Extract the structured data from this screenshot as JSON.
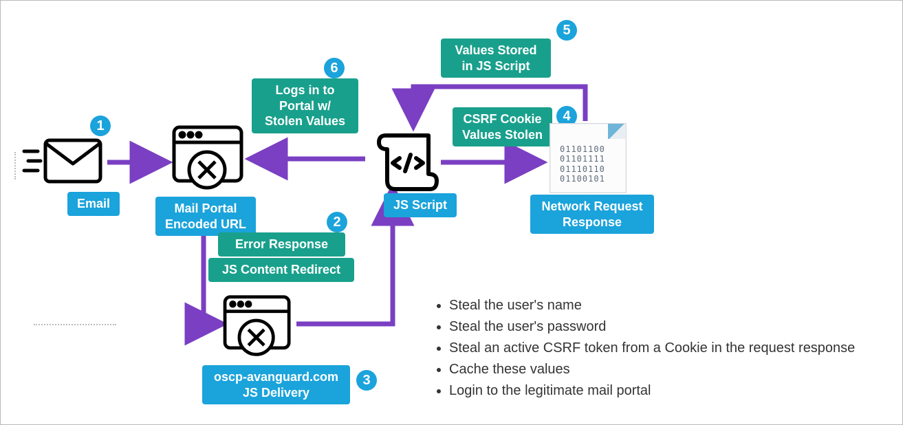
{
  "nodes": {
    "email": {
      "label": "Email"
    },
    "mailPortal": {
      "label": "Mail Portal\nEncoded URL"
    },
    "jsDelivery": {
      "label": "oscp-avanguard.com\nJS Delivery"
    },
    "jsScript": {
      "label": "JS Script"
    },
    "netResp": {
      "label": "Network Request\nResponse",
      "binary": [
        "01101100",
        "01101111",
        "01110110",
        "01100101"
      ]
    }
  },
  "steps": {
    "s1": {
      "num": "1"
    },
    "s2": {
      "num": "2",
      "lines": [
        "Error Response",
        "JS Content Redirect"
      ]
    },
    "s3": {
      "num": "3"
    },
    "s4": {
      "num": "4",
      "text": "CSRF Cookie\nValues Stolen"
    },
    "s5": {
      "num": "5",
      "text": "Values Stored\nin JS Script"
    },
    "s6": {
      "num": "6",
      "text": "Logs in to\nPortal w/\nStolen Values"
    }
  },
  "bullets": [
    "Steal the user's name",
    "Steal the user's password",
    "Steal an active CSRF token from a Cookie in the request response",
    "Cache these values",
    "Login to the legitimate mail portal"
  ],
  "colors": {
    "blue": "#1ba3db",
    "green": "#19a08c",
    "purple": "#7a3fc2"
  }
}
